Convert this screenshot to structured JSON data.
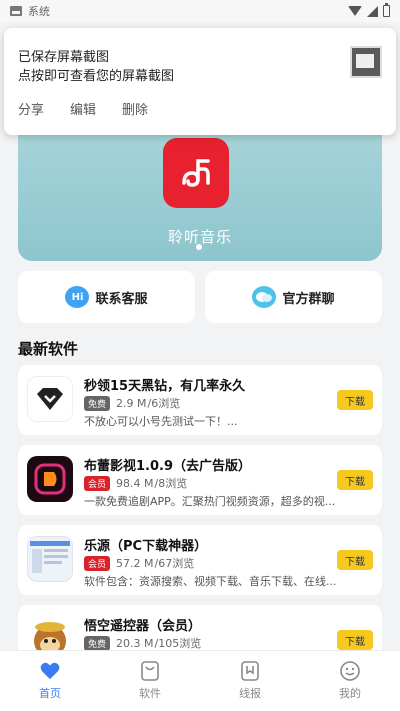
{
  "status_bar": {
    "label": "系统"
  },
  "notification": {
    "title": "已保存屏幕截图",
    "subtitle": "点按即可查看您的屏幕截图",
    "actions": [
      "分享",
      "编辑",
      "删除"
    ]
  },
  "banner": {
    "title": "聆听音乐"
  },
  "services": [
    {
      "label": "联系客服",
      "icon": "hi-icon"
    },
    {
      "label": "官方群聊",
      "icon": "chat-bubbles-icon"
    }
  ],
  "section": {
    "title": "最新软件"
  },
  "apps": [
    {
      "name": "秒领15天黑钻，有几率永久",
      "badge": "免费",
      "size": "2.9 M",
      "views": "/6浏览",
      "desc": "不放心可以小号先测试一下！...",
      "button": "下载"
    },
    {
      "name": "布蕾影视1.0.9（去广告版）",
      "badge": "会员",
      "size": "98.4 M",
      "views": "/8浏览",
      "desc": "一款免费追剧APP。汇聚热门视频资源，超多的视...",
      "button": "下载"
    },
    {
      "name": "乐源（PC下载神器）",
      "badge": "会员",
      "size": "57.2 M",
      "views": "/67浏览",
      "desc": "软件包含：资源搜索、视频下载、音乐下载、在线...",
      "button": "下载"
    },
    {
      "name": "悟空遥控器（会员）",
      "badge": "免费",
      "size": "20.3 M",
      "views": "/105浏览",
      "desc": "",
      "button": "下载"
    }
  ],
  "bottom_nav": [
    {
      "label": "首页",
      "icon": "heart-icon",
      "active": true
    },
    {
      "label": "软件",
      "icon": "bag-icon"
    },
    {
      "label": "线报",
      "icon": "bookmark-icon"
    },
    {
      "label": "我的",
      "icon": "smiley-icon"
    }
  ],
  "colors": {
    "accent": "#3a7bf3",
    "download": "#f7c81e",
    "vip_badge": "#d8232a",
    "free_badge": "#666666"
  }
}
